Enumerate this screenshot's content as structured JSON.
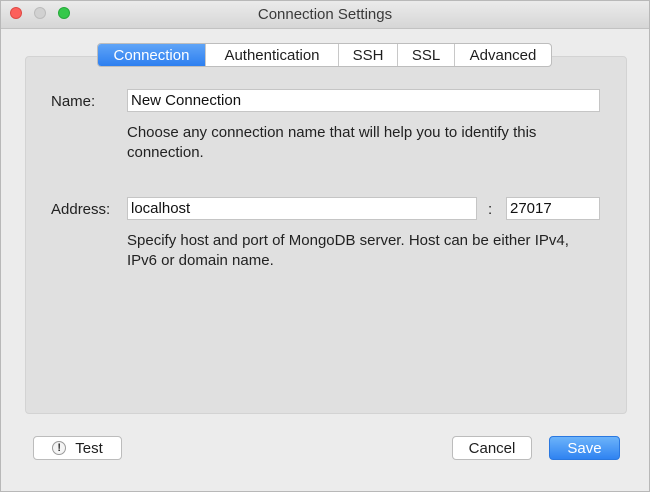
{
  "window": {
    "title": "Connection Settings"
  },
  "tabs": [
    {
      "label": "Connection",
      "active": true
    },
    {
      "label": "Authentication",
      "active": false
    },
    {
      "label": "SSH",
      "active": false
    },
    {
      "label": "SSL",
      "active": false
    },
    {
      "label": "Advanced",
      "active": false
    }
  ],
  "connection": {
    "name_label": "Name:",
    "name_value": "New Connection",
    "name_help": "Choose any connection name that will help you to identify this connection.",
    "address_label": "Address:",
    "host_value": "localhost",
    "port_separator": ":",
    "port_value": "27017",
    "address_help": "Specify host and port of MongoDB server. Host can be either IPv4, IPv6 or domain name."
  },
  "footer": {
    "test_icon": "!",
    "test_label": "Test",
    "cancel_label": "Cancel",
    "save_label": "Save"
  },
  "colors": {
    "accent": "#2f83f1",
    "close_button": "#fc605c",
    "zoom_button": "#34c84a"
  }
}
